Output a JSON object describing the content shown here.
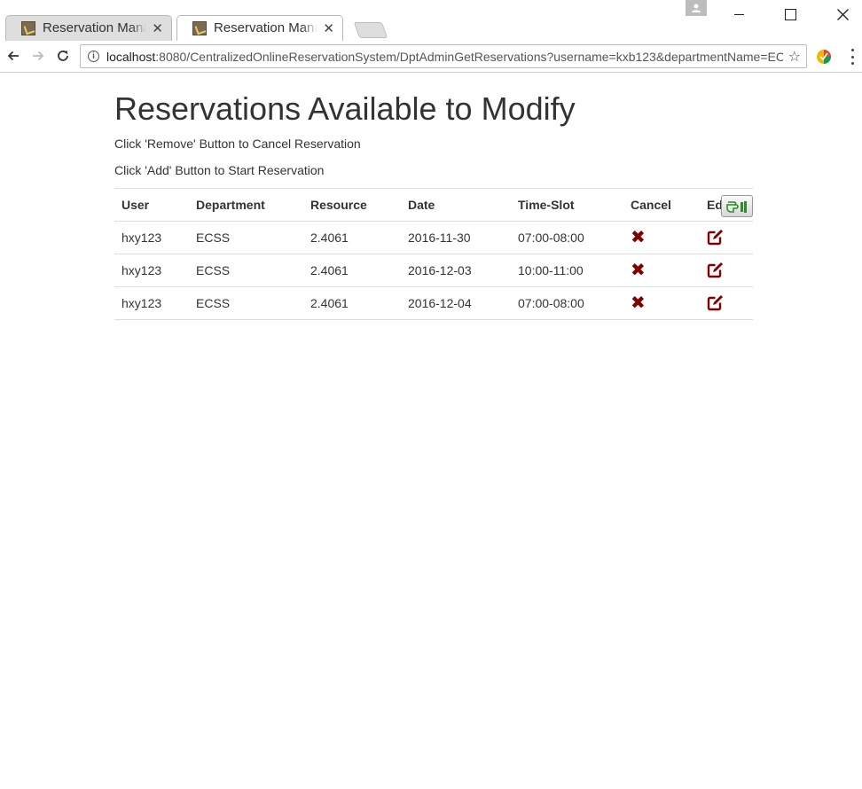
{
  "browser": {
    "tabs": [
      {
        "title": "Reservation Manage",
        "active": false
      },
      {
        "title": "Reservation Manage",
        "active": true
      }
    ],
    "close_glyph": "✕",
    "url": {
      "host": "localhost",
      "rest": ":8080/CentralizedOnlineReservationSystem/DptAdminGetReservations?username=kxb123&departmentName=ECSS"
    }
  },
  "page": {
    "title": "Reservations Available to Modify",
    "instruction_remove": "Click 'Remove' Button to Cancel Reservation",
    "instruction_add": "Click 'Add' Button to Start Reservation"
  },
  "table": {
    "headers": {
      "user": "User",
      "department": "Department",
      "resource": "Resource",
      "date": "Date",
      "time_slot": "Time-Slot",
      "cancel": "Cancel",
      "edit": "Ed"
    },
    "rows": [
      {
        "user": "hxy123",
        "department": "ECSS",
        "resource": "2.4061",
        "date": "2016-11-30",
        "time_slot": "07:00-08:00"
      },
      {
        "user": "hxy123",
        "department": "ECSS",
        "resource": "2.4061",
        "date": "2016-12-03",
        "time_slot": "10:00-11:00"
      },
      {
        "user": "hxy123",
        "department": "ECSS",
        "resource": "2.4061",
        "date": "2016-12-04",
        "time_slot": "07:00-08:00"
      }
    ],
    "cancel_icon_glyph": "✖"
  },
  "icons": {
    "cancel": "cancel-x-icon",
    "edit": "edit-pencil-icon",
    "add": "hand-pointer-icon"
  },
  "colors": {
    "icon_dark_red": "#800000",
    "add_icon_green": "#2e8b2e"
  }
}
